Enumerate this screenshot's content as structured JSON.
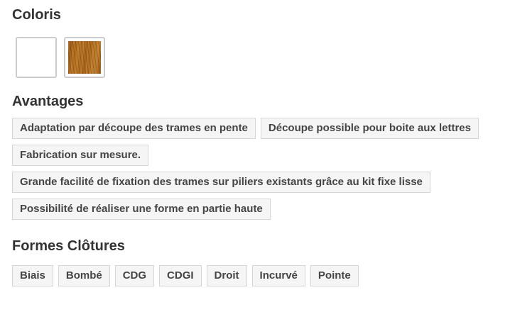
{
  "coloris": {
    "title": "Coloris",
    "swatches": [
      {
        "name": "white",
        "color": "#ffffff"
      },
      {
        "name": "wood",
        "color": "#a8661b"
      }
    ]
  },
  "avantages": {
    "title": "Avantages",
    "items": [
      "Adaptation par découpe des trames en pente",
      "Découpe possible pour boite aux lettres",
      "Fabrication sur mesure.",
      "Grande facilité de fixation des trames sur piliers existants grâce au kit fixe lisse",
      "Possibilité de réaliser une forme en partie haute"
    ]
  },
  "formes": {
    "title": "Formes Clôtures",
    "items": [
      "Biais",
      "Bombé",
      "CDG",
      "CDGI",
      "Droit",
      "Incurvé",
      "Pointe"
    ]
  }
}
